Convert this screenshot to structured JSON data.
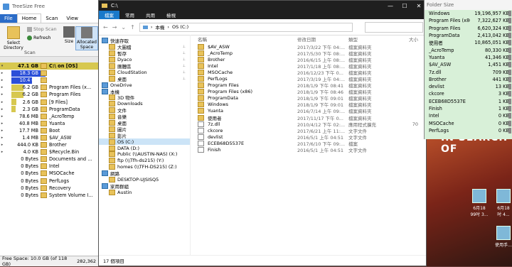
{
  "desktop": {
    "banner_text": "IN SEARCH OF",
    "icons": [
      {
        "label": "6月18\n99吋 3..."
      },
      {
        "label": "6月18\n吋 4..."
      },
      {
        "label": "使用手..."
      }
    ]
  },
  "treesize": {
    "title": "TreeSize Free",
    "tabs": {
      "file": "File",
      "home": "Home",
      "scan": "Scan",
      "view": "View"
    },
    "ribbon": {
      "select_directory": "Select\nDirectory",
      "stop_scan": "Stop Scan",
      "refresh": "Refresh",
      "scan_caption": "Scan",
      "size": "Size",
      "allocated_space": "Allocated\nSpace"
    },
    "tree": [
      {
        "size": "47.1 GB",
        "name": "C:\\ on [OS]",
        "root": true,
        "bar_color": "#d7c84f",
        "bar_pct": 100
      },
      {
        "size": "18.3 GB",
        "name": "Windows",
        "bar_color": "#2b4fd8",
        "bar_pct": 40,
        "text_color": "#fff"
      },
      {
        "size": "10.4 GB",
        "name": "Users",
        "bar_color": "#2b4fd8",
        "bar_pct": 24,
        "text_color": "#fff"
      },
      {
        "size": "6.2 GB",
        "name": "Program Files (x...",
        "bar_color": "#d7c84f",
        "bar_pct": 14
      },
      {
        "size": "6.2 GB",
        "name": "Program Files",
        "bar_color": "#d7c84f",
        "bar_pct": 14
      },
      {
        "size": "2.6 GB",
        "name": "[9 Files]",
        "bar_color": "#d7c84f",
        "bar_pct": 6
      },
      {
        "size": "2.3 GB",
        "name": "ProgramData",
        "bar_color": "#d7c84f",
        "bar_pct": 5
      },
      {
        "size": "78.6 MB",
        "name": "_AcroTemp"
      },
      {
        "size": "40.8 MB",
        "name": "Yuanta"
      },
      {
        "size": "17.7 MB",
        "name": "Boot"
      },
      {
        "size": "1.4 MB",
        "name": "$AV_ASW"
      },
      {
        "size": "444.0 KB",
        "name": "Brother"
      },
      {
        "size": "4.0 KB",
        "name": "$Recycle.Bin"
      },
      {
        "size": "0 Bytes",
        "name": "Documents and ..."
      },
      {
        "size": "0 Bytes",
        "name": "Intel"
      },
      {
        "size": "0 Bytes",
        "name": "MSOCache"
      },
      {
        "size": "0 Bytes",
        "name": "PerfLogs"
      },
      {
        "size": "0 Bytes",
        "name": "Recovery"
      },
      {
        "size": "0 Bytes",
        "name": "System Volume I..."
      }
    ],
    "status_free": "Free Space: 10.0 GB (of 118 GB)",
    "status_count": "282,362"
  },
  "explorer": {
    "title": "C:\\",
    "tabs": {
      "file": "檔案",
      "home": "常用",
      "share": "共用",
      "view": "檢視"
    },
    "address": {
      "part1": "本機",
      "part2": "OS (C:)"
    },
    "sidebar": [
      {
        "label": "快速存取",
        "icon": "star-icon"
      },
      {
        "label": "大圖檔",
        "pinned": true
      },
      {
        "label": "暫存",
        "pinned": true
      },
      {
        "label": "Dyaco",
        "pinned": true
      },
      {
        "label": "團體區",
        "pinned": true
      },
      {
        "label": "CloudStation",
        "pinned": true
      },
      {
        "label": "桌面",
        "pinned": true
      },
      {
        "label": "OneDrive",
        "icon": "cloud-icon"
      },
      {
        "label": "本機",
        "icon": "computer-icon"
      },
      {
        "label": "3D 物件"
      },
      {
        "label": "Downloads"
      },
      {
        "label": "文件"
      },
      {
        "label": "音樂"
      },
      {
        "label": "桌面"
      },
      {
        "label": "圖片"
      },
      {
        "label": "影片"
      },
      {
        "label": "OS (C:)",
        "selected": true
      },
      {
        "label": "DATA (D:)"
      },
      {
        "label": "Public (\\\\AUSTIN-NAS) (X:)"
      },
      {
        "label": "ftp (\\\\Tfh-ds215) (Y:)"
      },
      {
        "label": "homes (\\\\TFH-DS215) (Z:)"
      },
      {
        "label": "網路",
        "icon": "network-icon"
      },
      {
        "label": "DESKTOP-UJSISQ5"
      },
      {
        "label": "家用群組",
        "icon": "homegroup-icon"
      },
      {
        "label": "Austin"
      }
    ],
    "columns": {
      "name": "名稱",
      "date": "修改日期",
      "type": "類型",
      "size": "大小"
    },
    "files": [
      {
        "name": "$AV_ASW",
        "date": "2017/3/22 下午 04:...",
        "type": "檔案資料夾",
        "size": ""
      },
      {
        "name": "_AcroTemp",
        "date": "2017/5/30 下午 08:...",
        "type": "檔案資料夾",
        "size": ""
      },
      {
        "name": "Brother",
        "date": "2016/6/15 上午 08:...",
        "type": "檔案資料夾",
        "size": ""
      },
      {
        "name": "Intel",
        "date": "2017/1/18 上午 08:...",
        "type": "檔案資料夾",
        "size": ""
      },
      {
        "name": "MSOCache",
        "date": "2016/12/23 下午 0...",
        "type": "檔案資料夾",
        "size": ""
      },
      {
        "name": "PerfLogs",
        "date": "2017/3/19 上午 04:...",
        "type": "檔案資料夾",
        "size": ""
      },
      {
        "name": "Program Files",
        "date": "2018/1/9 下午 08:41",
        "type": "檔案資料夾",
        "size": ""
      },
      {
        "name": "Program Files (x86)",
        "date": "2018/1/9 下午 08:46",
        "type": "檔案資料夾",
        "size": ""
      },
      {
        "name": "ProgramData",
        "date": "2018/1/9 下午 09:01",
        "type": "檔案資料夾",
        "size": ""
      },
      {
        "name": "Windows",
        "date": "2018/1/9 下午 09:01",
        "type": "檔案資料夾",
        "size": ""
      },
      {
        "name": "Yuanta",
        "date": "2016/7/14 上午 09:...",
        "type": "檔案資料夾",
        "size": ""
      },
      {
        "name": "使用者",
        "date": "2017/11/17 下午 0...",
        "type": "檔案資料夾",
        "size": ""
      },
      {
        "name": "7z.dll",
        "date": "2010/4/12 下午 02:...",
        "type": "應用程式擴充",
        "size": "70",
        "file": true
      },
      {
        "name": "ckcore",
        "date": "2017/6/21 上午 11:...",
        "type": "文字文件",
        "size": "",
        "file": true
      },
      {
        "name": "devlist",
        "date": "2016/5/1 上午 04:51",
        "type": "文字文件",
        "size": "",
        "file": true
      },
      {
        "name": "ECEB68D5537E",
        "date": "2017/6/10 下午 09:...",
        "type": "檔案",
        "size": "",
        "file": true
      },
      {
        "name": "Finish",
        "date": "2016/5/1 上午 04:51",
        "type": "文字文件",
        "size": "",
        "file": true
      }
    ],
    "status": "17 個項目"
  },
  "foldersize": {
    "title": "Folder Size",
    "rows": [
      {
        "name": "Windows",
        "size": "19,196,957 KB"
      },
      {
        "name": "Program Files (x86)",
        "size": "7,322,627 KB"
      },
      {
        "name": "Program Files",
        "size": "6,620,324 KB"
      },
      {
        "name": "ProgramData",
        "size": "2,413,042 KB"
      },
      {
        "name": "使用者",
        "size": "10,865,051 KB"
      },
      {
        "name": "_AcroTemp",
        "size": "80,330 KB"
      },
      {
        "name": "Yuanta",
        "size": "41,346 KB"
      },
      {
        "name": "$AV_ASW",
        "size": "1,451 KB"
      },
      {
        "name": "7z.dll",
        "size": "709 KB"
      },
      {
        "name": "Brother",
        "size": "441 KB"
      },
      {
        "name": "devlist",
        "size": "13 KB"
      },
      {
        "name": "ckcore",
        "size": "3 KB"
      },
      {
        "name": "ECEB68D5537E",
        "size": "1 KB"
      },
      {
        "name": "Finish",
        "size": "1 KB"
      },
      {
        "name": "Intel",
        "size": "0 KB"
      },
      {
        "name": "MSOCache",
        "size": "0 KB"
      },
      {
        "name": "PerfLogs",
        "size": "0 KB"
      }
    ]
  }
}
